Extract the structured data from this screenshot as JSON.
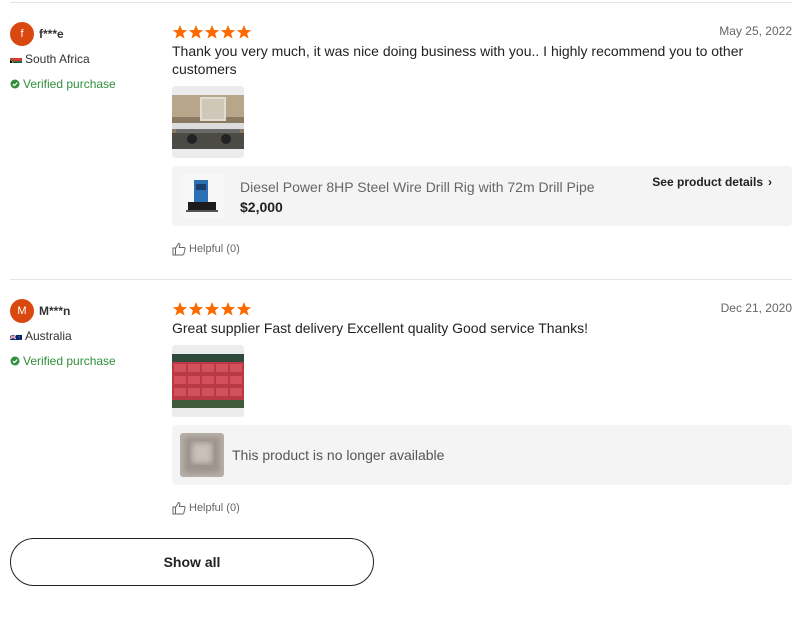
{
  "reviews": [
    {
      "avatar_letter": "f",
      "avatar_color": "#d9480f",
      "name": "f***e",
      "country": "South Africa",
      "verified": "Verified purchase",
      "rating": 5,
      "date": "May 25, 2022",
      "text": "Thank you very much, it was nice doing business with you.. I highly recommend you to other customers",
      "product": {
        "title": "Diesel Power 8HP Steel Wire Drill Rig with 72m Drill Pipe",
        "price": "$2,000",
        "details_label": "See product details"
      },
      "helpful": "Helpful (0)"
    },
    {
      "avatar_letter": "M",
      "avatar_color": "#d9480f",
      "name": "M***n",
      "country": "Australia",
      "verified": "Verified purchase",
      "rating": 5,
      "date": "Dec 21, 2020",
      "text": "Great supplier Fast delivery Excellent quality Good service Thanks!",
      "product": {
        "unavailable_text": "This product is no longer available"
      },
      "helpful": "Helpful (0)"
    }
  ],
  "show_all_label": "Show all",
  "colors": {
    "star": "#ff6a00",
    "verified": "#2f8f3a",
    "avatar": "#d9480f"
  }
}
